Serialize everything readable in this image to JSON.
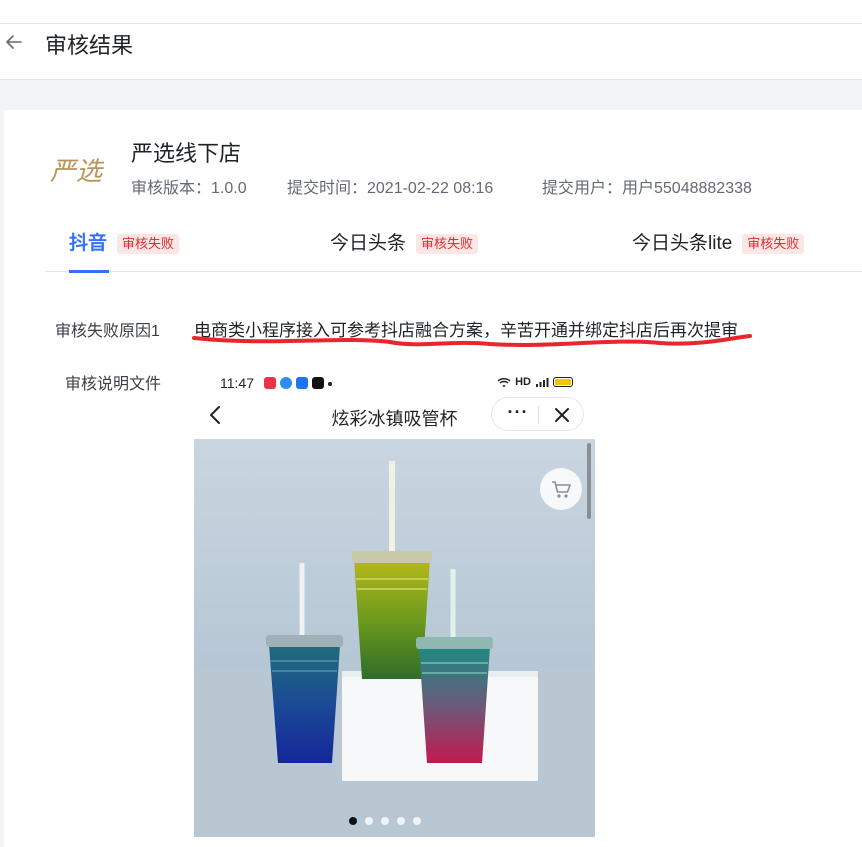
{
  "header": {
    "title": "审核结果"
  },
  "store": {
    "logo_text": "严选",
    "name": "严选线下店",
    "version_label": "审核版本：1.0.0",
    "submit_time_label": "提交时间：2021-02-22 08:16",
    "submit_user_label": "提交用户：用户55048882338"
  },
  "tabs": [
    {
      "label": "抖音",
      "badge": "审核失败",
      "active": true
    },
    {
      "label": "今日头条",
      "badge": "审核失败",
      "active": false
    },
    {
      "label": "今日头条lite",
      "badge": "审核失败",
      "active": false
    }
  ],
  "review": {
    "reason_label": "审核失败原因1",
    "reason_text": "电商类小程序接入可参考抖店融合方案，辛苦开通并绑定抖店后再次提审",
    "doc_label": "审核说明文件",
    "annotation_color": "#e8262d"
  },
  "phone": {
    "time": "11:47",
    "network": "HD",
    "page_title": "炫彩冰镇吸管杯",
    "more_label": "···",
    "carousel_count": 5,
    "carousel_active": 0
  },
  "colors": {
    "accent": "#3370ff",
    "fail_badge_text": "#e02d2d",
    "fail_badge_bg": "#fde6e6"
  }
}
